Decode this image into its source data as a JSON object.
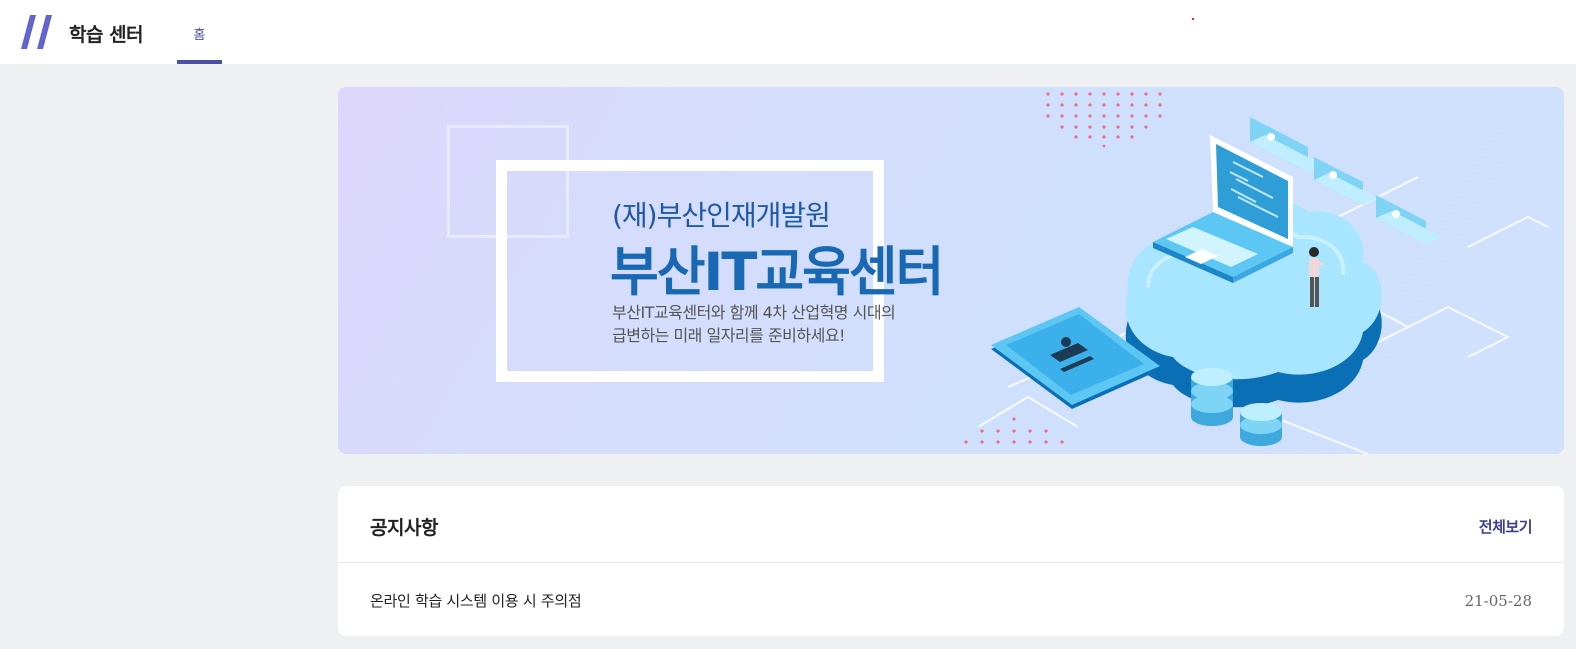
{
  "header": {
    "brand": "학습 센터",
    "tabs": [
      {
        "label": "홈",
        "active": true
      }
    ],
    "accent_color": "#4b4fa8"
  },
  "banner": {
    "org": "(재)부산인재개발원",
    "title": "부산IT교육센터",
    "desc_line1": "부산IT교육센터와 함께 4차 산업혁명 시대의",
    "desc_line2": "급변하는 미래 일자리를 준비하세요!"
  },
  "notice": {
    "title": "공지사항",
    "more_label": "전체보기",
    "items": [
      {
        "title": "온라인 학습 시스템 이용 시 주의점",
        "date": "21-05-28"
      }
    ]
  }
}
